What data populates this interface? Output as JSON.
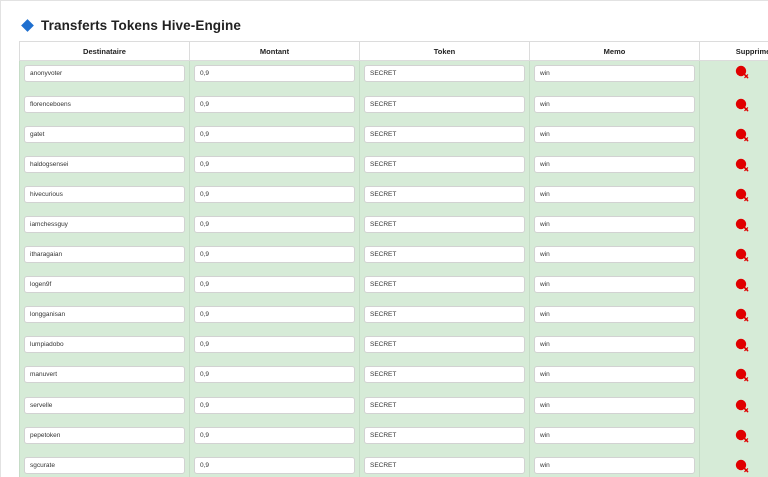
{
  "page": {
    "title": "Transferts Tokens Hive-Engine",
    "icon": "diamond-icon",
    "accent_color": "#1e6fcf"
  },
  "table": {
    "headers": [
      "Destinataire",
      "Montant",
      "Token",
      "Memo",
      "Supprimer"
    ],
    "row_color": "#d6ebd7",
    "delete_icon": "delete-icon",
    "delete_color": "#e00000",
    "rows": [
      {
        "recipient": "anonyvoter",
        "amount": "0,9",
        "token": "SECRET",
        "memo": "win"
      },
      {
        "recipient": "florenceboens",
        "amount": "0,9",
        "token": "SECRET",
        "memo": "win"
      },
      {
        "recipient": "gatet",
        "amount": "0,9",
        "token": "SECRET",
        "memo": "win"
      },
      {
        "recipient": "haldogsensei",
        "amount": "0,9",
        "token": "SECRET",
        "memo": "win"
      },
      {
        "recipient": "hivecurious",
        "amount": "0,9",
        "token": "SECRET",
        "memo": "win"
      },
      {
        "recipient": "iamchessguy",
        "amount": "0,9",
        "token": "SECRET",
        "memo": "win"
      },
      {
        "recipient": "itharagaian",
        "amount": "0,9",
        "token": "SECRET",
        "memo": "win"
      },
      {
        "recipient": "logen9f",
        "amount": "0,9",
        "token": "SECRET",
        "memo": "win"
      },
      {
        "recipient": "longganisan",
        "amount": "0,9",
        "token": "SECRET",
        "memo": "win"
      },
      {
        "recipient": "lumpiadobo",
        "amount": "0,9",
        "token": "SECRET",
        "memo": "win"
      },
      {
        "recipient": "manuvert",
        "amount": "0,9",
        "token": "SECRET",
        "memo": "win"
      },
      {
        "recipient": "servelle",
        "amount": "0,9",
        "token": "SECRET",
        "memo": "win"
      },
      {
        "recipient": "pepetoken",
        "amount": "0,9",
        "token": "SECRET",
        "memo": "win"
      },
      {
        "recipient": "sgcurate",
        "amount": "0,9",
        "token": "SECRET",
        "memo": "win"
      }
    ]
  }
}
